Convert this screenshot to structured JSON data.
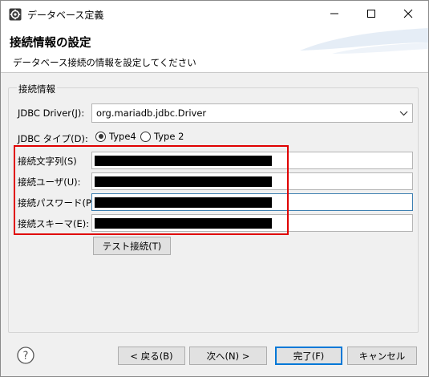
{
  "window": {
    "title": "データベース定義",
    "icon": "settings-gear-icon"
  },
  "header": {
    "title": "接続情報の設定",
    "description": "データベース接続の情報を設定してください"
  },
  "group": {
    "label": "接続情報",
    "driver_label": "JDBC Driver(J):",
    "driver_value": "org.mariadb.jdbc.Driver",
    "type_label": "JDBC タイプ(D):",
    "type_options": [
      "Type4",
      "Type 2"
    ],
    "type_selected": "Type4",
    "conn_string_label": "接続文字列(S)",
    "user_label": "接続ユーザ(U):",
    "password_label": "接続パスワード(P):",
    "schema_label": "接続スキーマ(E):",
    "test_button": "テスト接続(T)"
  },
  "footer": {
    "help_icon": "help-question-icon",
    "back_button": "< 戻る(B)",
    "next_button": "次へ(N) >",
    "finish_button": "完了(F)",
    "cancel_button": "キャンセル"
  },
  "colors": {
    "highlight": "#e00000",
    "focus": "#3c7fb1",
    "default_button": "#0078d7"
  }
}
